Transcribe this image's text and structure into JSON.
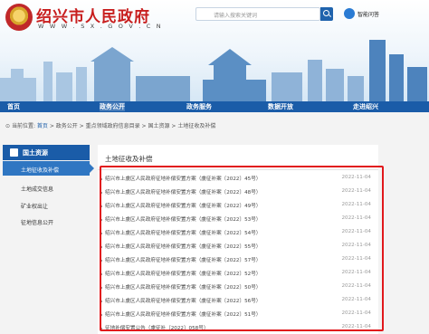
{
  "header": {
    "site_title": "绍兴市人民政府",
    "site_url": "W W W . S X . G O V . C N",
    "search_placeholder": "请输入搜索关键词",
    "ai_label": "智能问答"
  },
  "nav": {
    "items": [
      {
        "label": "首页"
      },
      {
        "label": "政务公开"
      },
      {
        "label": "政务服务"
      },
      {
        "label": "数据开放"
      },
      {
        "label": "走进绍兴"
      }
    ]
  },
  "breadcrumb": {
    "prefix": "当前位置:",
    "home": "首页",
    "sep": " > ",
    "items": [
      "政务公开",
      "重点领域政府信息目录",
      "国土资源",
      "土地征收及补偿"
    ]
  },
  "sidebar": {
    "title": "国土资源",
    "items": [
      {
        "label": "土地征收及补偿"
      },
      {
        "label": "土地成交信息"
      },
      {
        "label": "矿业权出让"
      },
      {
        "label": "征地信息公开"
      }
    ]
  },
  "content": {
    "title": "土地征收及补偿",
    "rows": [
      {
        "title": "绍兴市上虞区人民政府征地补偿安置方案（虞征补案〔2022〕45号）",
        "date": "2022-11-04"
      },
      {
        "title": "绍兴市上虞区人民政府征地补偿安置方案（虞征补案〔2022〕48号）",
        "date": "2022-11-04"
      },
      {
        "title": "绍兴市上虞区人民政府征地补偿安置方案（虞征补案〔2022〕49号）",
        "date": "2022-11-04"
      },
      {
        "title": "绍兴市上虞区人民政府征地补偿安置方案（虞征补案〔2022〕53号）",
        "date": "2022-11-04"
      },
      {
        "title": "绍兴市上虞区人民政府征地补偿安置方案（虞征补案〔2022〕54号）",
        "date": "2022-11-04"
      },
      {
        "title": "绍兴市上虞区人民政府征地补偿安置方案（虞征补案〔2022〕55号）",
        "date": "2022-11-04"
      },
      {
        "title": "绍兴市上虞区人民政府征地补偿安置方案（虞征补案〔2022〕57号）",
        "date": "2022-11-04"
      },
      {
        "title": "绍兴市上虞区人民政府征地补偿安置方案（虞征补案〔2022〕52号）",
        "date": "2022-11-04"
      },
      {
        "title": "绍兴市上虞区人民政府征地补偿安置方案（虞征补案〔2022〕50号）",
        "date": "2022-11-04"
      },
      {
        "title": "绍兴市上虞区人民政府征地补偿安置方案（虞征补案〔2022〕56号）",
        "date": "2022-11-04"
      },
      {
        "title": "绍兴市上虞区人民政府征地补偿安置方案（虞征补案〔2022〕51号）",
        "date": "2022-11-04"
      },
      {
        "title": "征地补偿安置公告（虞征补〔2022〕058号）",
        "date": "2022-11-04"
      }
    ]
  },
  "colors": {
    "brand_blue": "#1a5ca8",
    "title_red": "#c81e1e",
    "highlight_red": "#e1181c"
  }
}
